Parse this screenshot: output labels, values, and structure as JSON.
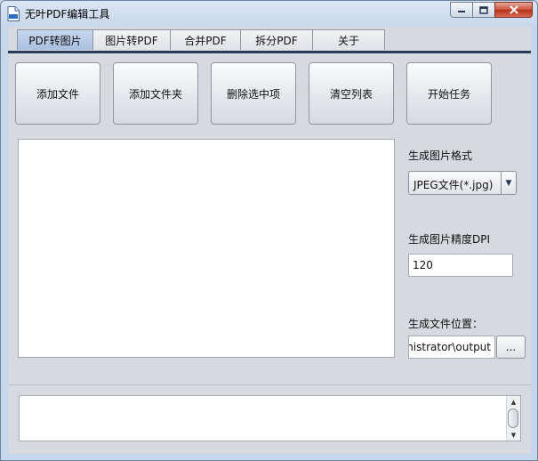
{
  "window": {
    "title": "无叶PDF编辑工具"
  },
  "tabs": [
    {
      "label": "PDF转图片",
      "active": true
    },
    {
      "label": "图片转PDF"
    },
    {
      "label": "合并PDF"
    },
    {
      "label": "拆分PDF"
    },
    {
      "label": "关于"
    }
  ],
  "toolbar": {
    "add_file": "添加文件",
    "add_folder": "添加文件夹",
    "delete_selected": "删除选中项",
    "clear_list": "清空列表",
    "start_task": "开始任务"
  },
  "settings": {
    "format_label": "生成图片格式",
    "format_value": "JPEG文件(*.jpg)",
    "dpi_label": "生成图片精度DPI",
    "dpi_value": "120",
    "output_label": "生成文件位置：",
    "output_value": "\\inistrator\\output",
    "browse_label": "..."
  },
  "colors": {
    "accent": "#2b3b55",
    "active_tab": "#b9cde9",
    "close_button": "#c9523c"
  },
  "icons": {
    "app": "pdf-file-icon",
    "minimize": "minimize-icon",
    "maximize": "maximize-icon",
    "close": "close-icon"
  }
}
